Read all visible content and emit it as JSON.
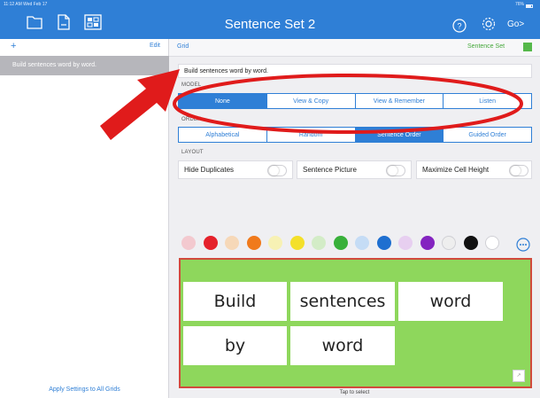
{
  "status_bar": {
    "time": "11:12 AM  Wed Feb 17",
    "battery": "76%"
  },
  "topbar": {
    "title": "Sentence Set 2",
    "go_label": "Go"
  },
  "left_panel": {
    "add_label": "+",
    "edit_label": "Edit",
    "items": [
      {
        "label": "Build sentences word by word."
      }
    ],
    "apply_label": "Apply Settings to All Grids"
  },
  "right_panel": {
    "grid_label": "Grid",
    "set_label": "Sentence Set",
    "description": "Build sentences word by word.",
    "model": {
      "label": "MODEL",
      "options": [
        "None",
        "View & Copy",
        "View & Remember",
        "Listen"
      ],
      "selected": "None"
    },
    "order": {
      "label": "ORDER",
      "options": [
        "Alphabetical",
        "Random",
        "Sentence Order",
        "Guided Order"
      ],
      "selected": "Sentence Order"
    },
    "layout": {
      "label": "LAYOUT",
      "hide_duplicates": {
        "label": "Hide Duplicates",
        "on": false
      },
      "sentence_picture": {
        "label": "Sentence Picture",
        "on": false
      },
      "maximize_cell_height": {
        "label": "Maximize Cell Height",
        "on": false
      }
    },
    "palette": [
      "#f3c9cf",
      "#e5212b",
      "#f6d8b8",
      "#f07a1c",
      "#f7f1b4",
      "#f4e02a",
      "#d3ecc7",
      "#38b03a",
      "#c5dcf5",
      "#1f6fd0",
      "#e7cff0",
      "#8424c0",
      "#eeeeee",
      "#111111",
      "#ffffff"
    ],
    "selected_color": "#8ed75c",
    "grid_words": [
      "Build",
      "sentences",
      "word",
      "by",
      "word"
    ],
    "tap_label": "Tap to select"
  },
  "colors": {
    "accent": "#2f7fd6",
    "set_green": "#55b84a",
    "annotation_red": "#e01b1b"
  }
}
